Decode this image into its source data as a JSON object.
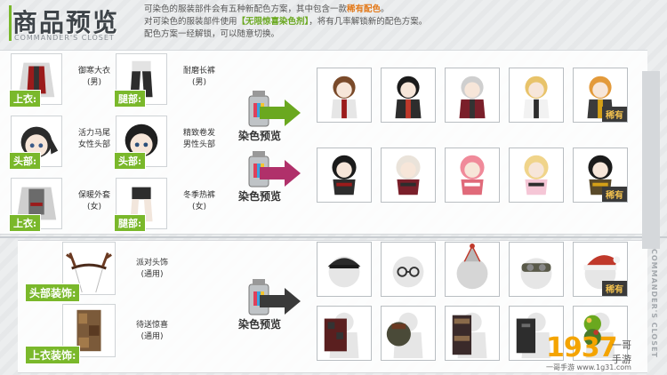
{
  "header": {
    "title": "商品预览",
    "subtitle": "COMMANDER'S CLOSET",
    "line1_pre": "可染色的服装部件会有五种新配色方案，其中包含一款",
    "line1_rare": "稀有配色",
    "line1_post": "。",
    "line2_pre": "对可染色的服装部件使用",
    "line2_item": "【无限惊喜染色剂】",
    "line2_post": "，将有几率解锁新的配色方案。",
    "line3": "配色方案一经解锁，可以随意切换。"
  },
  "parts": [
    {
      "tag": "上衣:",
      "name": "御寒大衣\n(男)"
    },
    {
      "tag": "腿部:",
      "name": "耐磨长裤\n(男)"
    },
    {
      "tag": "头部:",
      "name": "活力马尾\n女性头部"
    },
    {
      "tag": "头部:",
      "name": "精致卷发\n男性头部"
    },
    {
      "tag": "上衣:",
      "name": "保暖外套\n(女)"
    },
    {
      "tag": "腿部:",
      "name": "冬季热裤\n(女)"
    }
  ],
  "accessories": [
    {
      "tag": "头部装饰:",
      "name": "派对头饰\n(通用)"
    },
    {
      "tag": "上衣装饰:",
      "name": "待送惊喜\n(通用)"
    }
  ],
  "dye_label": "染色预览",
  "rare_label": "稀有",
  "side_text": "COMMANDER'S CLOSET",
  "watermark": {
    "num": "1937",
    "side": "一哥",
    "side2": "手游",
    "url": "一哥手游 www.1g31.com"
  },
  "colors": {
    "accent": "#7ab82b",
    "rare_badge": "#f2c14e"
  }
}
